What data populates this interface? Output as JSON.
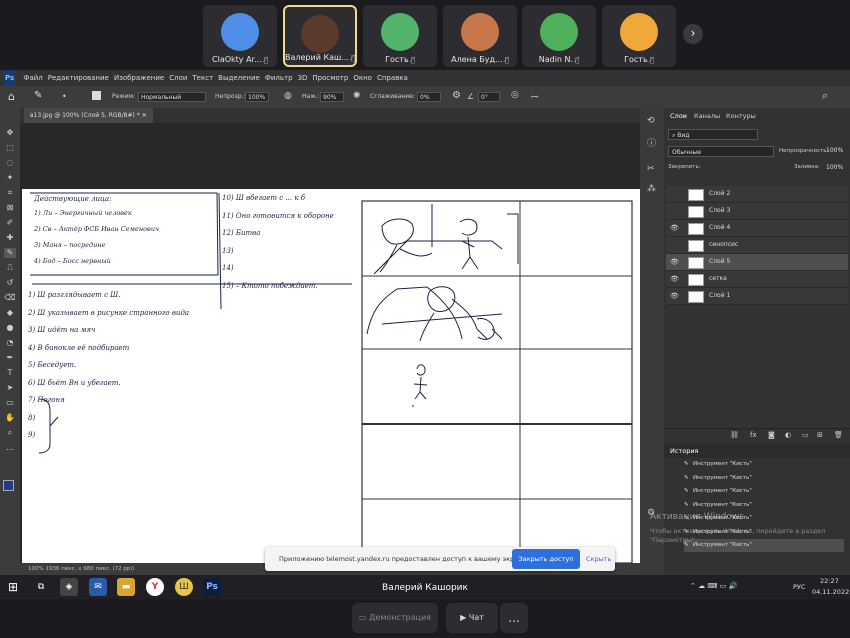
{
  "participants": [
    {
      "name": "ClaOkty Ar...",
      "muted": true,
      "active": false,
      "avatar": "dolphin-avatar",
      "color": "#4d8fe6"
    },
    {
      "name": "Валерий Каш...",
      "muted": true,
      "active": true,
      "avatar": "user-photo",
      "color": "#5a3a2a"
    },
    {
      "name": "Гость",
      "muted": true,
      "active": false,
      "avatar": "rabbit-avatar",
      "color": "#52b36a"
    },
    {
      "name": "Алена Буд...",
      "muted": true,
      "active": false,
      "avatar": "user-photo",
      "color": "#c8774a"
    },
    {
      "name": "Nadin N.",
      "muted": true,
      "active": false,
      "avatar": "cat-avatar",
      "color": "#4fb05c"
    },
    {
      "name": "Гость",
      "muted": true,
      "active": false,
      "avatar": "alpaca-avatar",
      "color": "#f0a838"
    }
  ],
  "next_icon": "chevron-right-icon",
  "photoshop": {
    "app_icon": "Ps",
    "menu": [
      "Файл",
      "Редактирование",
      "Изображение",
      "Слои",
      "Текст",
      "Выделение",
      "Фильтр",
      "3D",
      "Просмотр",
      "Окно",
      "Справка"
    ],
    "options": {
      "mode_label": "Режим:",
      "mode_value": "Нормальный",
      "opacity_label": "Непрозр.:",
      "opacity_value": "100%",
      "pressure_label": "Наж.:",
      "pressure_value": "90%",
      "smoothing_label": "Сглаживание:",
      "smoothing_value": "0%",
      "angle_value": "0°"
    },
    "doc_tab": "в13.jpg @ 100% (Слой 5, RGB/8#) *",
    "status": "100%     1936 пикс. x 980 пикс. (72 ppi)",
    "panel_tabs": [
      "Слои",
      "Каналы",
      "Контуры"
    ],
    "layers_search": "Вид",
    "blend_mode": "Обычные",
    "opacity_label": "Непрозрачность:",
    "opacity_value": "100%",
    "lock_label": "Закрепить:",
    "fill_label": "Заливка:",
    "fill_value": "100%",
    "layers": [
      {
        "name": "Слой 2",
        "visible": false,
        "selected": false
      },
      {
        "name": "Слой 3",
        "visible": false,
        "selected": false
      },
      {
        "name": "Слой 4",
        "visible": true,
        "selected": false
      },
      {
        "name": "синопсис",
        "visible": false,
        "selected": false
      },
      {
        "name": "Слой 5",
        "visible": true,
        "selected": true
      },
      {
        "name": "сетка",
        "visible": true,
        "selected": false
      },
      {
        "name": "Слой 1",
        "visible": true,
        "selected": false
      }
    ],
    "history_title": "История",
    "history": [
      "Инструмент \"Кисть\"",
      "Инструмент \"Кисть\"",
      "Инструмент \"Кисть\"",
      "Инструмент \"Кисть\"",
      "Инструмент \"Кисть\"",
      "Инструмент \"Кисть\"",
      "Инструмент \"Кисть\""
    ]
  },
  "canvas_notes": {
    "header": "Действующие лица:",
    "cast": [
      "1) Ли – Энергичный человек",
      "2) Св – Актёр ФСБ  Иван Семенович",
      "3) Маня – посредине",
      "4) Бод – Босс нервный"
    ],
    "left_list": [
      "1) Ш разглядывает с Ш.",
      "2) Ш указывает в рисунке странного вида",
      "3) Ш идёт на мяч",
      "4) В бинокле её подбирает",
      "5) Беседует.",
      "6) Ш бьёт Вн и убегает.",
      "7) Погоня",
      "8)",
      "9)"
    ],
    "right_list": [
      "10) Ш вбегает с ... к б",
      "11) Оно готовится к обороне",
      "12) Битва",
      "13)",
      "14)",
      "15) – Ктото побеждает."
    ]
  },
  "notification": {
    "text": "Приложению telemost.yandex.ru предоставлен доступ к вашему экрану.",
    "button": "Закрыть доступ",
    "hide": "Скрыть"
  },
  "watermark": {
    "title": "Активация Windows",
    "subtitle": "Чтобы активировать Windows, перейдите в раздел \"Параметры\"."
  },
  "taskbar": {
    "lang": "РУС",
    "time": "22:27",
    "date": "04.11.2022"
  },
  "speaker_name": "Валерий Кашорик",
  "controls": {
    "demo": "Демонстрация",
    "chat": "Чат",
    "more": "..."
  }
}
